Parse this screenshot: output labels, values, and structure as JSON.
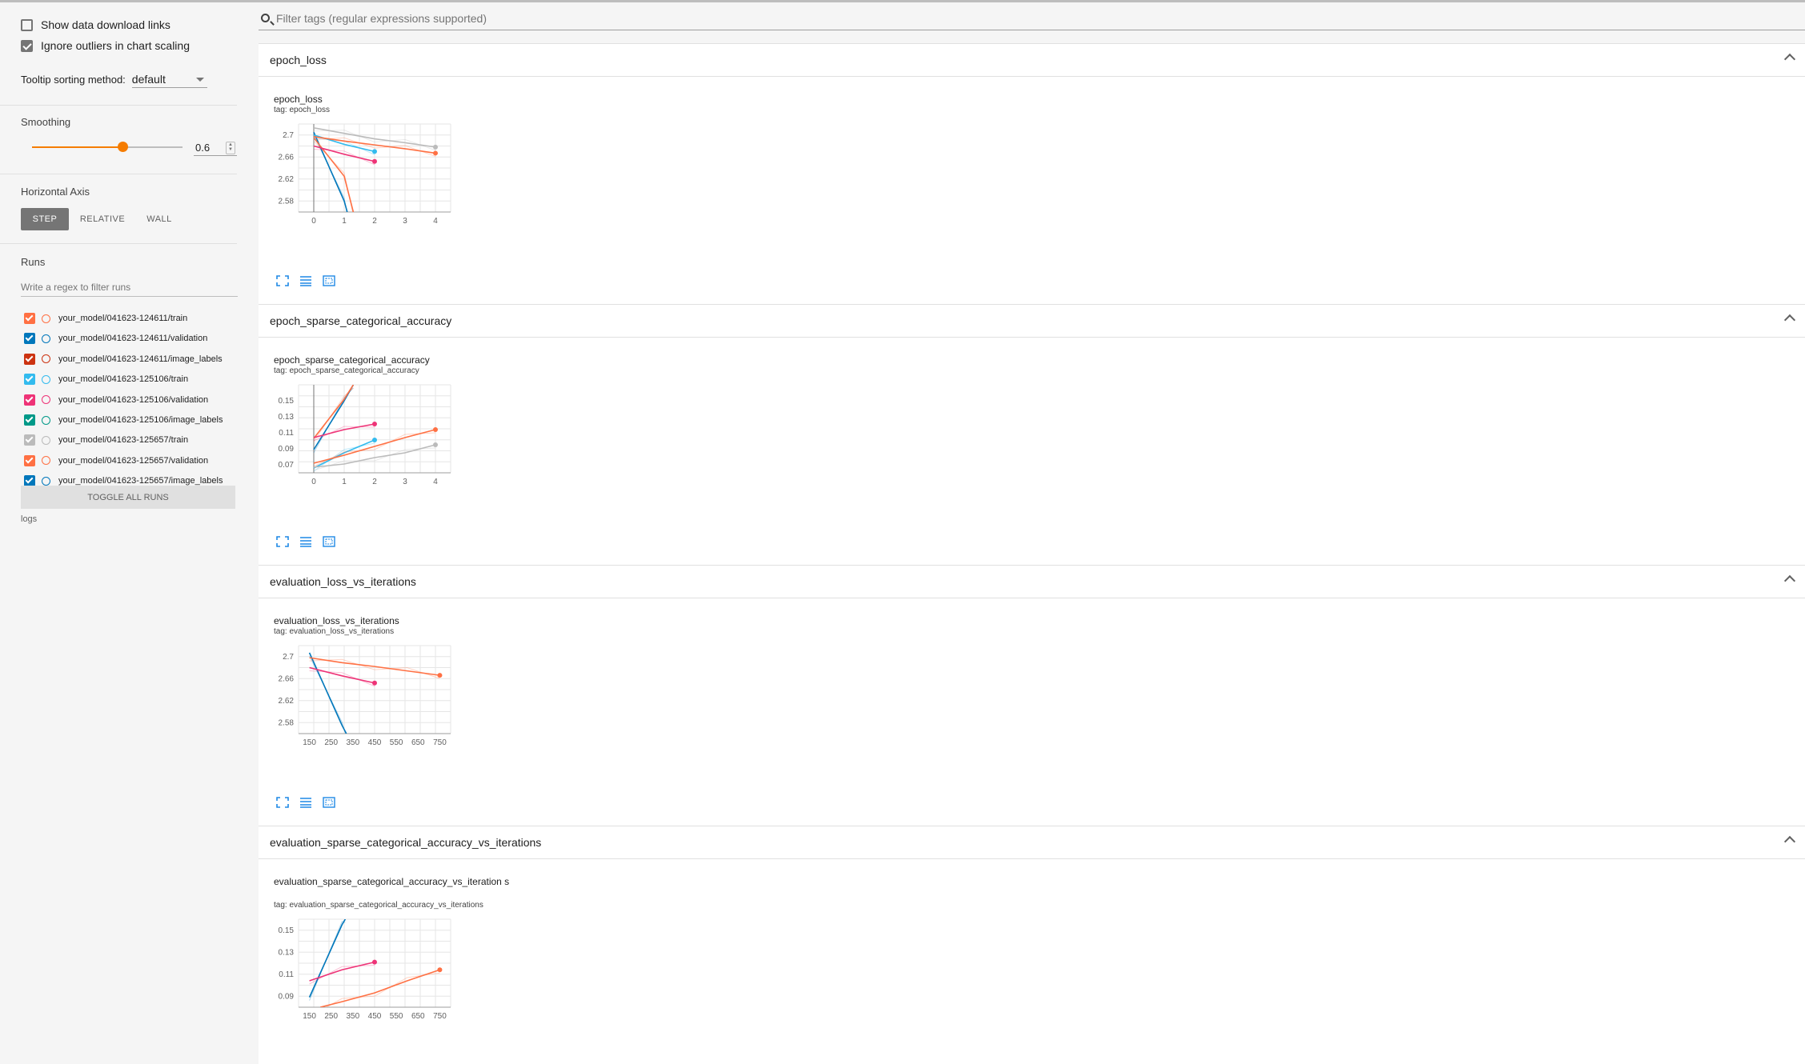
{
  "sidebar": {
    "show_download_label": "Show data download links",
    "show_download_checked": false,
    "ignore_outliers_label": "Ignore outliers in chart scaling",
    "ignore_outliers_checked": true,
    "tooltip_sort_label": "Tooltip sorting method:",
    "tooltip_sort_value": "default",
    "smoothing_label": "Smoothing",
    "smoothing_value": "0.6",
    "smoothing_fraction": 0.6,
    "horizontal_axis_label": "Horizontal Axis",
    "axis_options": [
      "STEP",
      "RELATIVE",
      "WALL"
    ],
    "axis_selected": "STEP",
    "runs_label": "Runs",
    "runs_filter_placeholder": "Write a regex to filter runs",
    "runs": [
      {
        "name": "your_model/041623-124611/train",
        "color": "#ff7043",
        "checked": true
      },
      {
        "name": "your_model/041623-124611/validation",
        "color": "#0077bb",
        "checked": true
      },
      {
        "name": "your_model/041623-124611/image_labels",
        "color": "#cc3311",
        "checked": true
      },
      {
        "name": "your_model/041623-125106/train",
        "color": "#33bbee",
        "checked": true
      },
      {
        "name": "your_model/041623-125106/validation",
        "color": "#ee3377",
        "checked": true
      },
      {
        "name": "your_model/041623-125106/image_labels",
        "color": "#009988",
        "checked": true
      },
      {
        "name": "your_model/041623-125657/train",
        "color": "#bbbbbb",
        "checked": true
      },
      {
        "name": "your_model/041623-125657/validation",
        "color": "#ff7043",
        "checked": true
      },
      {
        "name": "your_model/041623-125657/image_labels",
        "color": "#0077bb",
        "checked": true
      }
    ],
    "toggle_all_label": "TOGGLE ALL RUNS",
    "logs_label": "logs"
  },
  "main": {
    "filter_placeholder": "Filter tags (regular expressions supported)",
    "cards": [
      {
        "header": "epoch_loss",
        "chart_title": "epoch_loss",
        "tag": "tag: epoch_loss"
      },
      {
        "header": "epoch_sparse_categorical_accuracy",
        "chart_title": "epoch_sparse_categorical_accuracy",
        "tag": "tag: epoch_sparse_categorical_accuracy"
      },
      {
        "header": "evaluation_loss_vs_iterations",
        "chart_title": "evaluation_loss_vs_iterations",
        "tag": "tag: evaluation_loss_vs_iterations"
      },
      {
        "header": "evaluation_sparse_categorical_accuracy_vs_iterations",
        "chart_title": "evaluation_sparse_categorical_accuracy_vs_iteration s",
        "tag": "tag: evaluation_sparse_categorical_accuracy_vs_iterations"
      }
    ]
  },
  "chart_data": [
    {
      "type": "line",
      "title": "epoch_loss",
      "xticks": [
        "0",
        "1",
        "2",
        "3",
        "4"
      ],
      "yticks": [
        "2.7",
        "2.66",
        "2.62",
        "2.58"
      ],
      "xlim": [
        -0.5,
        4.5
      ],
      "ylim": [
        2.56,
        2.72
      ],
      "series": [
        {
          "color": "#0077bb",
          "x": [
            0,
            1,
            1.1
          ],
          "y": [
            2.705,
            2.58,
            2.56
          ]
        },
        {
          "color": "#ff7043",
          "x": [
            0,
            1,
            1.3
          ],
          "y": [
            2.695,
            2.625,
            2.56
          ]
        },
        {
          "color": "#33bbee",
          "x": [
            0,
            1,
            2
          ],
          "y": [
            2.7,
            2.683,
            2.67
          ]
        },
        {
          "color": "#ee3377",
          "x": [
            0,
            1,
            2
          ],
          "y": [
            2.68,
            2.665,
            2.652
          ]
        },
        {
          "color": "#bbbbbb",
          "x": [
            0,
            1,
            2,
            3,
            4
          ],
          "y": [
            2.713,
            2.703,
            2.693,
            2.686,
            2.678
          ]
        },
        {
          "color": "#ff7043",
          "x": [
            0,
            1,
            2,
            3,
            4
          ],
          "y": [
            2.697,
            2.689,
            2.682,
            2.675,
            2.667
          ]
        }
      ]
    },
    {
      "type": "line",
      "title": "epoch_sparse_categorical_accuracy",
      "xticks": [
        "0",
        "1",
        "2",
        "3",
        "4"
      ],
      "yticks": [
        "0.15",
        "0.13",
        "0.11",
        "0.09",
        "0.07"
      ],
      "xlim": [
        -0.5,
        4.5
      ],
      "ylim": [
        0.06,
        0.17
      ],
      "series": [
        {
          "color": "#0077bb",
          "x": [
            0,
            1,
            1.3
          ],
          "y": [
            0.089,
            0.15,
            0.17
          ]
        },
        {
          "color": "#ff7043",
          "x": [
            0,
            1,
            1.3
          ],
          "y": [
            0.103,
            0.152,
            0.17
          ]
        },
        {
          "color": "#ee3377",
          "x": [
            0,
            1,
            2
          ],
          "y": [
            0.104,
            0.114,
            0.121
          ]
        },
        {
          "color": "#33bbee",
          "x": [
            0,
            1,
            2
          ],
          "y": [
            0.066,
            0.085,
            0.101
          ]
        },
        {
          "color": "#ff7043",
          "x": [
            0,
            1,
            2,
            3,
            4
          ],
          "y": [
            0.072,
            0.082,
            0.093,
            0.104,
            0.114
          ]
        },
        {
          "color": "#bbbbbb",
          "x": [
            0,
            1,
            2,
            3,
            4
          ],
          "y": [
            0.067,
            0.071,
            0.079,
            0.085,
            0.095
          ]
        }
      ]
    },
    {
      "type": "line",
      "title": "evaluation_loss_vs_iterations",
      "xticks": [
        "150",
        "250",
        "350",
        "450",
        "550",
        "650",
        "750"
      ],
      "yticks": [
        "2.7",
        "2.66",
        "2.62",
        "2.58"
      ],
      "xlim": [
        100,
        800
      ],
      "ylim": [
        2.56,
        2.72
      ],
      "series": [
        {
          "color": "#0077bb",
          "x": [
            150,
            300,
            320
          ],
          "y": [
            2.707,
            2.575,
            2.56
          ]
        },
        {
          "color": "#ee3377",
          "x": [
            150,
            300,
            450
          ],
          "y": [
            2.68,
            2.665,
            2.652
          ]
        },
        {
          "color": "#ff7043",
          "x": [
            150,
            300,
            450,
            600,
            750
          ],
          "y": [
            2.698,
            2.689,
            2.682,
            2.674,
            2.666
          ]
        }
      ]
    },
    {
      "type": "line",
      "title": "evaluation_sparse_categorical_accuracy_vs_iteration s",
      "xticks": [
        "150",
        "250",
        "350",
        "450",
        "550",
        "650",
        "750"
      ],
      "yticks": [
        "0.15",
        "0.13",
        "0.11",
        "0.09"
      ],
      "xlim": [
        100,
        800
      ],
      "ylim": [
        0.08,
        0.16
      ],
      "series": [
        {
          "color": "#0077bb",
          "x": [
            150,
            300,
            315
          ],
          "y": [
            0.089,
            0.155,
            0.16
          ]
        },
        {
          "color": "#ee3377",
          "x": [
            150,
            300,
            450
          ],
          "y": [
            0.104,
            0.114,
            0.121
          ]
        },
        {
          "color": "#ff7043",
          "x": [
            200,
            300,
            450,
            600,
            750
          ],
          "y": [
            0.08,
            0.085,
            0.093,
            0.104,
            0.114
          ]
        }
      ]
    }
  ]
}
